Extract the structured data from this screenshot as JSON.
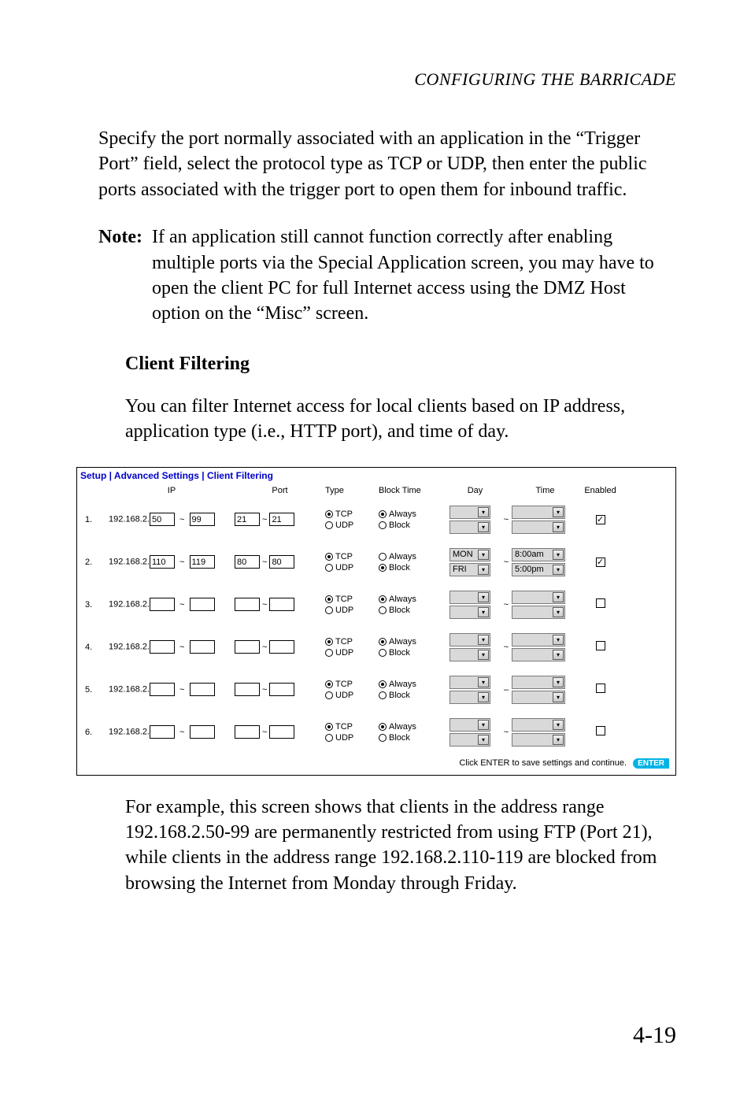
{
  "running_head": "CONFIGURING THE BARRICADE",
  "para1": "Specify the port normally associated with an application in the “Trigger Port” field, select the protocol type as TCP or UDP, then enter the public ports associated with the trigger port to open them for inbound traffic.",
  "note_label": "Note:",
  "note_body": "If an application still cannot function correctly after enabling multiple ports via the Special Application screen, you may have to open the client PC for full Internet access using the DMZ Host option on the “Misc” screen.",
  "subhead": "Client Filtering",
  "para2": "You can filter Internet access for local clients based on IP address, application type (i.e., HTTP port), and time of day.",
  "para3": "For example, this screen shows that clients in the address range 192.168.2.50-99 are permanently restricted from using FTP (Port 21), while clients in the address range 192.168.2.110-119 are blocked from browsing the Internet from Monday through Friday.",
  "page_number": "4-19",
  "screenshot": {
    "breadcrumb": "Setup | Advanced Settings | Client Filtering",
    "headers": {
      "ip": "IP",
      "port": "Port",
      "type": "Type",
      "block": "Block Time",
      "day": "Day",
      "time": "Time",
      "enabled": "Enabled"
    },
    "ip_prefix": "192.168.2.",
    "type_labels": {
      "tcp": "TCP",
      "udp": "UDP"
    },
    "block_labels": {
      "always": "Always",
      "block": "Block"
    },
    "rows": [
      {
        "n": "1.",
        "ip_from": "50",
        "ip_to": "99",
        "port_from": "21",
        "port_to": "21",
        "type": "tcp",
        "block": "always",
        "day_from": "",
        "day_to": "",
        "time_from": "",
        "time_to": "",
        "sep": "~",
        "enabled": true
      },
      {
        "n": "2.",
        "ip_from": "110",
        "ip_to": "119",
        "port_from": "80",
        "port_to": "80",
        "type": "tcp",
        "block": "block",
        "day_from": "MON",
        "day_to": "FRI",
        "time_from": "8:00am",
        "time_to": "5:00pm",
        "sep": "~",
        "enabled": true
      },
      {
        "n": "3.",
        "ip_from": "",
        "ip_to": "",
        "port_from": "",
        "port_to": "",
        "type": "tcp",
        "block": "always",
        "day_from": "",
        "day_to": "",
        "time_from": "",
        "time_to": "",
        "sep": "~",
        "enabled": false
      },
      {
        "n": "4.",
        "ip_from": "",
        "ip_to": "",
        "port_from": "",
        "port_to": "",
        "type": "tcp",
        "block": "always",
        "day_from": "",
        "day_to": "",
        "time_from": "",
        "time_to": "",
        "sep": "~",
        "enabled": false
      },
      {
        "n": "5.",
        "ip_from": "",
        "ip_to": "",
        "port_from": "",
        "port_to": "",
        "type": "tcp",
        "block": "always",
        "day_from": "",
        "day_to": "",
        "time_from": "",
        "time_to": "",
        "sep": "–",
        "enabled": false
      },
      {
        "n": "6.",
        "ip_from": "",
        "ip_to": "",
        "port_from": "",
        "port_to": "",
        "type": "tcp",
        "block": "always",
        "day_from": "",
        "day_to": "",
        "time_from": "",
        "time_to": "",
        "sep": "~",
        "enabled": false
      }
    ],
    "save_text": "Click ENTER to save settings and continue.",
    "enter_label": "ENTER"
  }
}
